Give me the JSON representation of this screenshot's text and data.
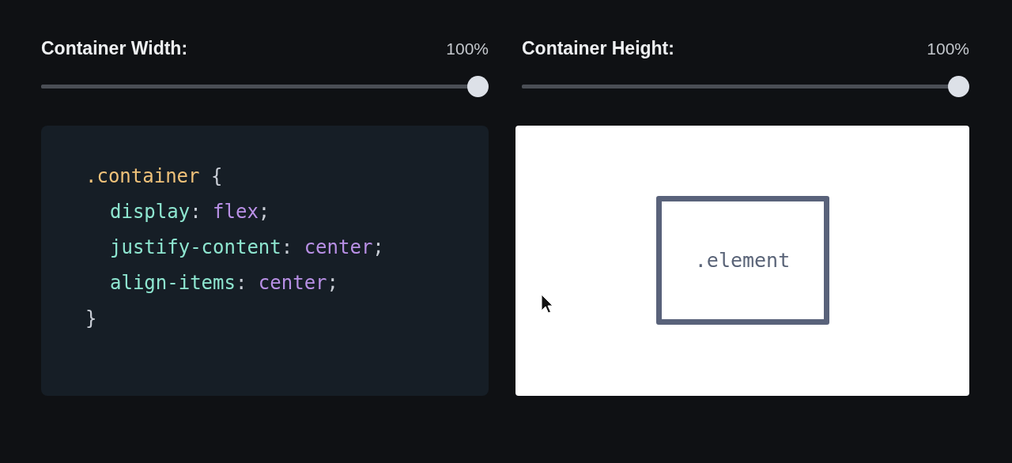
{
  "controls": [
    {
      "label": "Container Width:",
      "reading": "100%",
      "level": 1
    },
    {
      "label": "Container Height:",
      "reading": "100%",
      "level": 1
    }
  ],
  "code": [
    {
      "indent": false,
      "tokens": [
        {
          "kind": "selector",
          "text": ".container"
        },
        {
          "kind": "punct",
          "text": " {"
        }
      ]
    },
    {
      "indent": true,
      "tokens": [
        {
          "kind": "property",
          "text": "display"
        },
        {
          "kind": "punct",
          "text": ": "
        },
        {
          "kind": "value",
          "text": "flex"
        },
        {
          "kind": "punct",
          "text": ";"
        }
      ]
    },
    {
      "indent": true,
      "tokens": [
        {
          "kind": "property",
          "text": "justify-content"
        },
        {
          "kind": "punct",
          "text": ": "
        },
        {
          "kind": "value",
          "text": "center"
        },
        {
          "kind": "punct",
          "text": ";"
        }
      ]
    },
    {
      "indent": true,
      "tokens": [
        {
          "kind": "property",
          "text": "align-items"
        },
        {
          "kind": "punct",
          "text": ": "
        },
        {
          "kind": "value",
          "text": "center"
        },
        {
          "kind": "punct",
          "text": ";"
        }
      ]
    },
    {
      "indent": false,
      "tokens": [
        {
          "kind": "punct",
          "text": "}"
        }
      ]
    }
  ],
  "preview": {
    "element_label": ".element"
  }
}
